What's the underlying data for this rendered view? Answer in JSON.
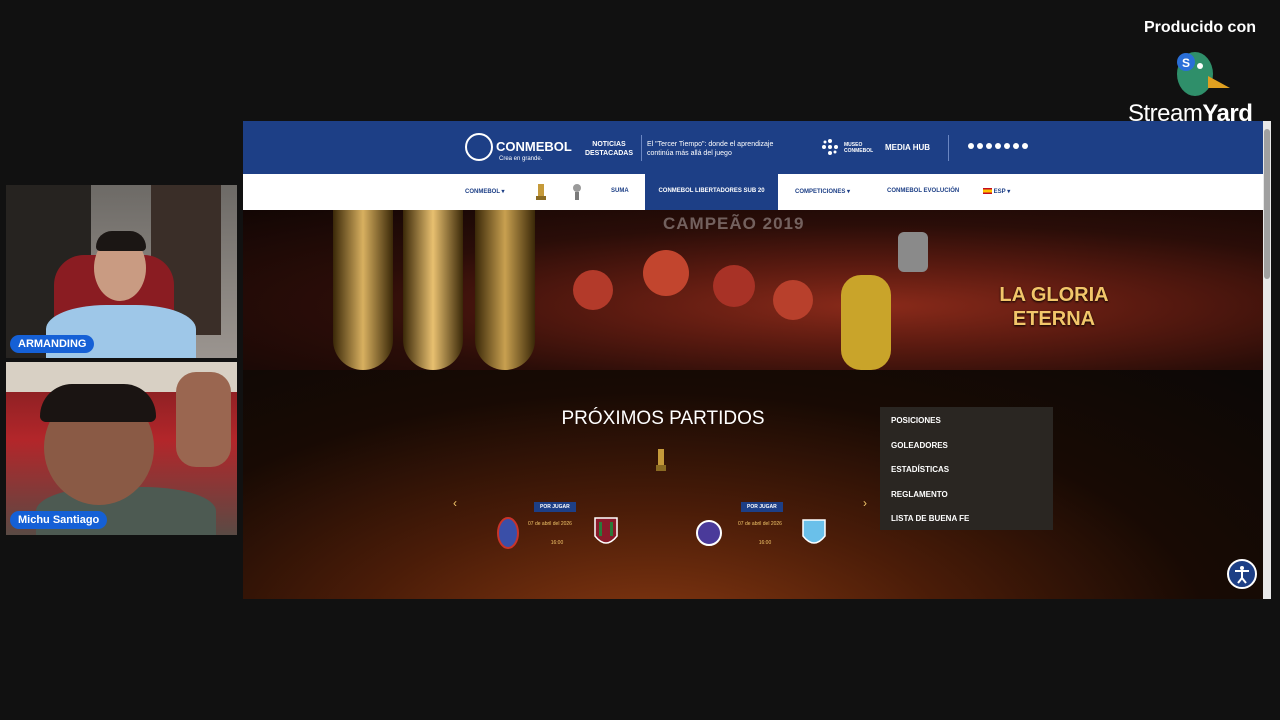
{
  "participants": [
    {
      "name": "ARMANDING"
    },
    {
      "name": "Michu Santiago"
    }
  ],
  "branding": {
    "produced_label": "Producido con",
    "brand_light": "Stream",
    "brand_bold": "Yard"
  },
  "site": {
    "topbar": {
      "logo_text": "CONMEBOL",
      "logo_tagline": "Crea en grande.",
      "noticias": "NOTICIAS DESTACADAS",
      "headline": "El \"Tercer Tiempo\": donde el aprendizaje continúa más allá del juego",
      "museo": "MUSEO CONMEBOL",
      "media_hub": "MEDIA HUB",
      "social_icons": [
        "facebook-icon",
        "x-icon",
        "youtube-icon",
        "linkedin-icon",
        "instagram-icon",
        "tiktok-icon",
        "whatsapp-icon"
      ]
    },
    "nav": {
      "conmebol": "CONMEBOL",
      "suma": "SUMA",
      "active": "CONMEBOL LIBERTADORES SUB 20",
      "competiciones": "COMPETICIONES",
      "evolucion": "CONMEBOL EVOLUCIÓN",
      "language": "ESP"
    },
    "banner": {
      "campeao": "CAMPEÃO 2019",
      "title_line1": "LA GLORIA",
      "title_line2": "ETERNA"
    },
    "matches_section": {
      "title": "PRÓXIMOS PARTIDOS",
      "prev_arrow": "‹",
      "next_arrow": "›",
      "matches": [
        {
          "status": "POR JUGAR",
          "date": "07 de abril del 2026",
          "time": "16:00"
        },
        {
          "status": "POR JUGAR",
          "date": "07 de abril del 2026",
          "time": "16:00"
        }
      ]
    },
    "dropdown": {
      "items": [
        "POSICIONES",
        "GOLEADORES",
        "ESTADÍSTICAS",
        "REGLAMENTO",
        "LISTA DE BUENA FE"
      ]
    }
  },
  "colors": {
    "brand_blue": "#1d3f86",
    "gold": "#f2c66a",
    "badge_blue": "#1560d6"
  }
}
